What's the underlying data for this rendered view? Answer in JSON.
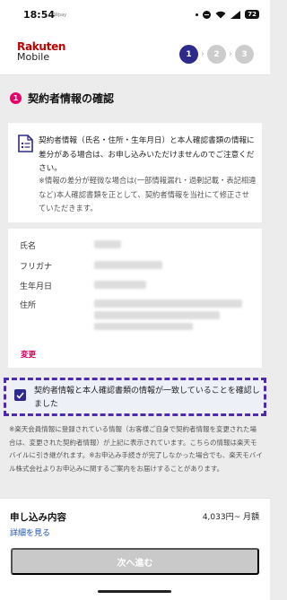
{
  "status_bar": {
    "time": "18:54",
    "sub_indicator": "Wpay",
    "battery": "72"
  },
  "header": {
    "logo_line1": "Rakuten",
    "logo_line2": "Mobile",
    "steps": [
      "1",
      "2",
      "3"
    ],
    "active_step": "1"
  },
  "section": {
    "number": "1",
    "title": "契約者情報の確認"
  },
  "notice": {
    "icon": "document-list-icon",
    "main": "契約者情報（氏名・住所・生年月日）と本人確認書類の情報に差分がある場合は、お申し込みいただけませんのでご注意ください。",
    "sub": "※情報の差分が軽微な場合は(一部情報漏れ・過剰記載・表記相違など)本人確認書類を正として、契約者情報を当社にて修正させていただきます。"
  },
  "info": {
    "name_label": "氏名",
    "kana_label": "フリガナ",
    "birthdate_label": "生年月日",
    "address_label": "住所",
    "change_link": "変更"
  },
  "confirm": {
    "checked": true,
    "text": "契約者情報と本人確認書類の情報が一致していることを確認しました"
  },
  "footnote": "※楽天会員情報に登録されている情報（お客様ご自身で契約者情報を変更された場合は、変更された契約者情報）が上記に表示されています。こちらの情報は楽天モバイルに引き継がれます。※お申込み手続きが完了しなかった場合でも、楽天モバイル株式会社よりお申込みに関するご案内をお届けすることがあります。",
  "bottom": {
    "label": "申し込み内容",
    "price": "4,033円~ 月額",
    "detail_link": "詳細を見る",
    "next_button": "次へ進む"
  },
  "colors": {
    "accent": "#2d2a8b",
    "brand": "#bf0000",
    "badge": "#e5006a",
    "link": "#1f4fb4",
    "disabled": "#c9c9c9"
  }
}
